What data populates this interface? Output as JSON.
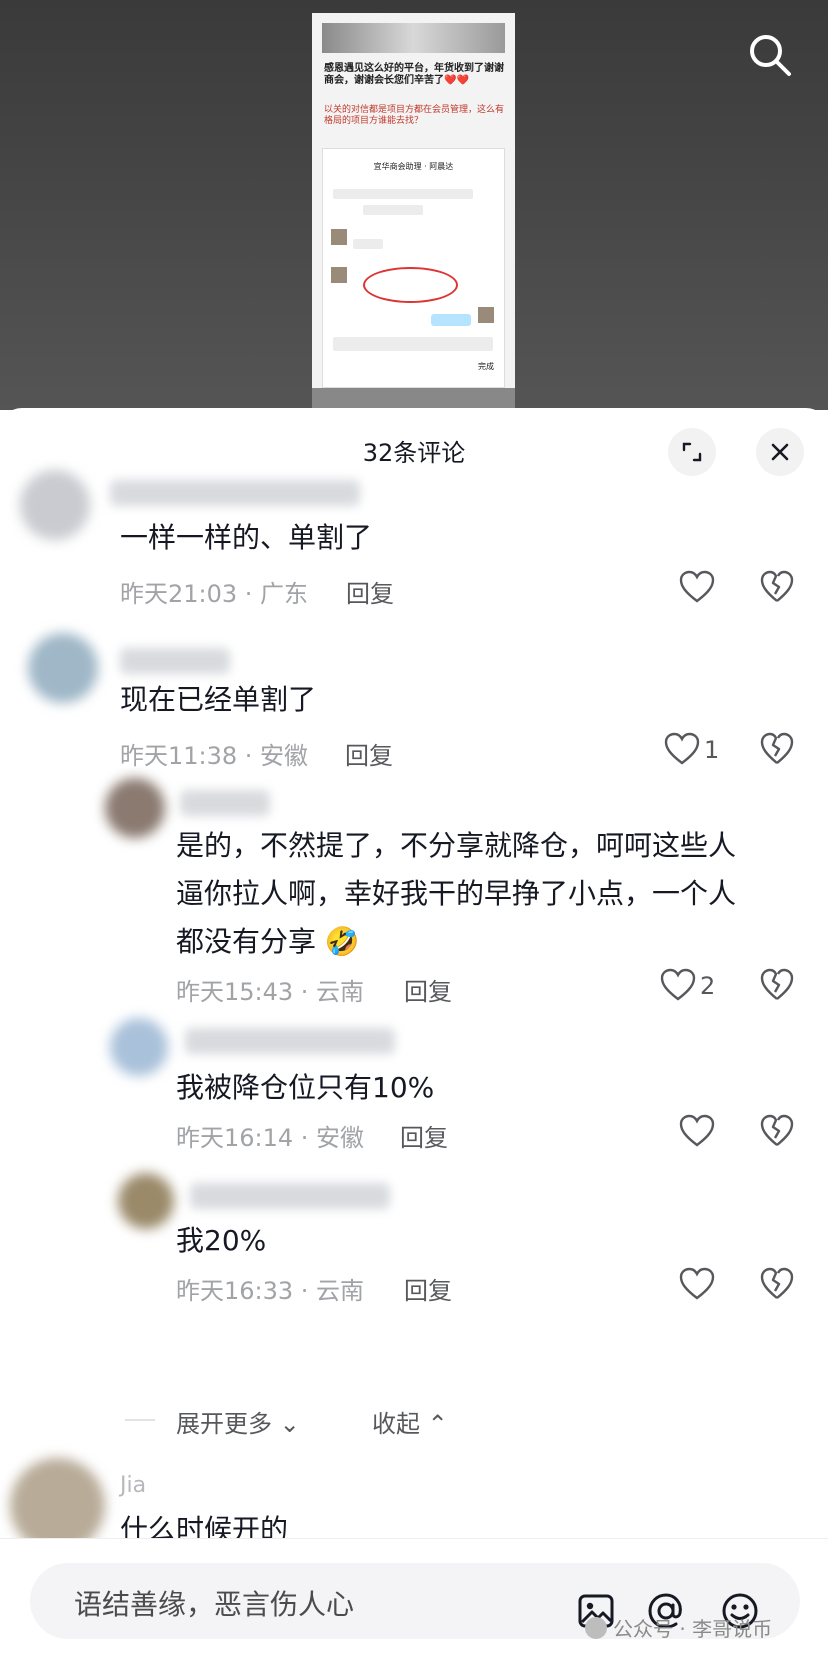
{
  "video": {
    "thumb_text_1": "感恩遇见这么好的平台，年货收到了谢谢商会，谢谢会长您们辛苦了❤️❤️",
    "thumb_text_2": "以关的对信都是项目方都在会员管理，这么有格局的项目方谁能去找？",
    "thumb_chat_title": "宜华商会助理 · 阿晨达",
    "thumb_done": "完成"
  },
  "sheet": {
    "title": "32条评论"
  },
  "comments": [
    {
      "text": "一样一样的、单割了",
      "meta": "昨天21:03 · 广东",
      "reply": "回复",
      "likes": ""
    },
    {
      "text": "现在已经单割了",
      "meta": "昨天11:38 · 安徽",
      "reply": "回复",
      "likes": "1"
    },
    {
      "text_1": "是的，不然提了，不分享就降仓，呵呵这些人",
      "text_2": "逼你拉人啊，幸好我干的早挣了小点，一个人",
      "text_3": "都没有分享 🤣",
      "meta": "昨天15:43 · 云南",
      "reply": "回复",
      "likes": "2"
    },
    {
      "text": "我被降仓位只有10%",
      "meta": "昨天16:14 · 安徽",
      "reply": "回复",
      "likes": ""
    },
    {
      "text": "我20%",
      "meta": "昨天16:33 · 云南",
      "reply": "回复",
      "likes": ""
    }
  ],
  "actions": {
    "expand_more": "展开更多",
    "collapse": "收起"
  },
  "next_comment": {
    "name": "Jia",
    "text": "什么时候开的"
  },
  "input": {
    "placeholder": "语结善缘，恶言伤人心"
  },
  "watermark": {
    "text": "公众号 · 李哥说币"
  },
  "icons": {
    "search": "search-icon",
    "expand": "expand-icon",
    "close": "close-icon",
    "like": "heart-icon",
    "dislike": "broken-heart-icon",
    "image": "image-icon",
    "mention": "at-icon",
    "emoji": "emoji-icon"
  }
}
